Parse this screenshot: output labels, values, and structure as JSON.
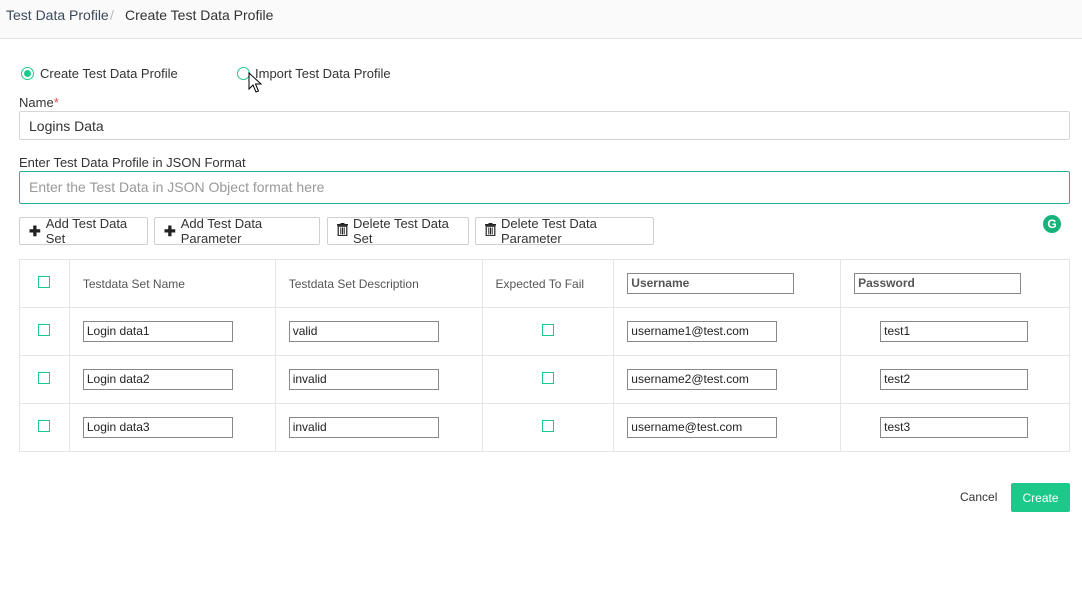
{
  "breadcrumb": {
    "parent": "Test Data Profile",
    "separator": "/",
    "current": "Create Test Data Profile"
  },
  "mode": {
    "create_label": "Create Test Data Profile",
    "import_label": "Import Test Data Profile",
    "selected": "create"
  },
  "form": {
    "name_label": "Name",
    "name_required": "*",
    "name_value": "Logins Data",
    "json_label": "Enter Test Data Profile in JSON Format",
    "json_placeholder": "Enter the Test Data in JSON Object format here"
  },
  "toolbar": {
    "add_set": "Add Test Data Set",
    "add_param": "Add Test Data Parameter",
    "delete_set": "Delete Test Data Set",
    "delete_param": "Delete Test Data Parameter",
    "add_icon": "plus-icon",
    "delete_icon": "trash-icon"
  },
  "grammarly_icon": "grammarly-icon",
  "table": {
    "headers": {
      "set_name": "Testdata Set Name",
      "set_description": "Testdata Set Description",
      "expected_to_fail": "Expected To Fail",
      "param1": "Username",
      "param2": "Password"
    },
    "rows": [
      {
        "name": "Login data1",
        "description": "valid",
        "username": "username1@test.com",
        "password": "test1"
      },
      {
        "name": "Login data2",
        "description": "invalid",
        "username": "username2@test.com",
        "password": "test2"
      },
      {
        "name": "Login data3",
        "description": "invalid",
        "username": "username@test.com",
        "password": "test3"
      }
    ]
  },
  "footer": {
    "cancel": "Cancel",
    "create": "Create"
  },
  "colors": {
    "accent": "#1dc98a",
    "focus_border": "#24b3a3",
    "required": "#e5484d"
  }
}
